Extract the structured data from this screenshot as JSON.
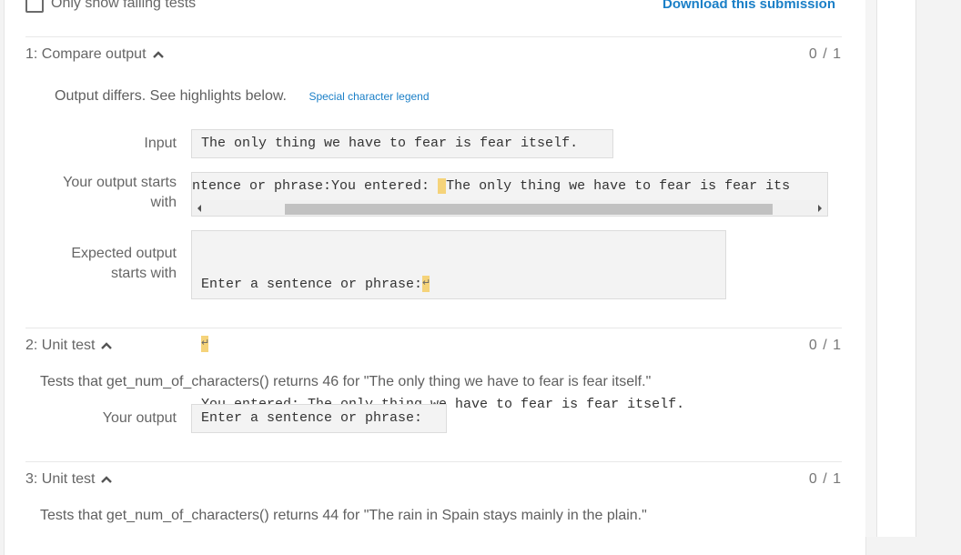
{
  "filter": {
    "only_failing_label": "Only show failing tests",
    "checked": false
  },
  "download_label": "Download this submission",
  "tests": [
    {
      "title": "1: Compare output",
      "score": "0 / 1",
      "message": "Output differs. See highlights below.",
      "legend_link": "Special character legend",
      "input_label": "Input",
      "input_value": "The only thing we have to fear is fear itself.",
      "your_output_label_line1": "Your output starts",
      "your_output_label_line2": "with",
      "your_output_before": "ntence or phrase:You entered: ",
      "your_output_highlight": " ",
      "your_output_after": "The only thing we have to fear is fear its",
      "expected_label_line1": "Expected output",
      "expected_label_line2": "starts with",
      "expected_line1": "Enter a sentence or phrase:",
      "expected_line3": "You entered: The only thing we have to fear is fear itself.",
      "newline_symbol": "↵"
    },
    {
      "title": "2: Unit test",
      "score": "0 / 1",
      "description": "Tests that get_num_of_characters() returns 46 for \"The only thing we have to fear is fear itself.\"",
      "your_output_label": "Your output",
      "your_output_value": "Enter a sentence or phrase:"
    },
    {
      "title": "3: Unit test",
      "score": "0 / 1",
      "description": "Tests that get_num_of_characters() returns 44 for \"The rain in Spain stays mainly in the plain.\""
    }
  ],
  "colors": {
    "link": "#1a7fc7",
    "highlight": "#f5d37a"
  }
}
